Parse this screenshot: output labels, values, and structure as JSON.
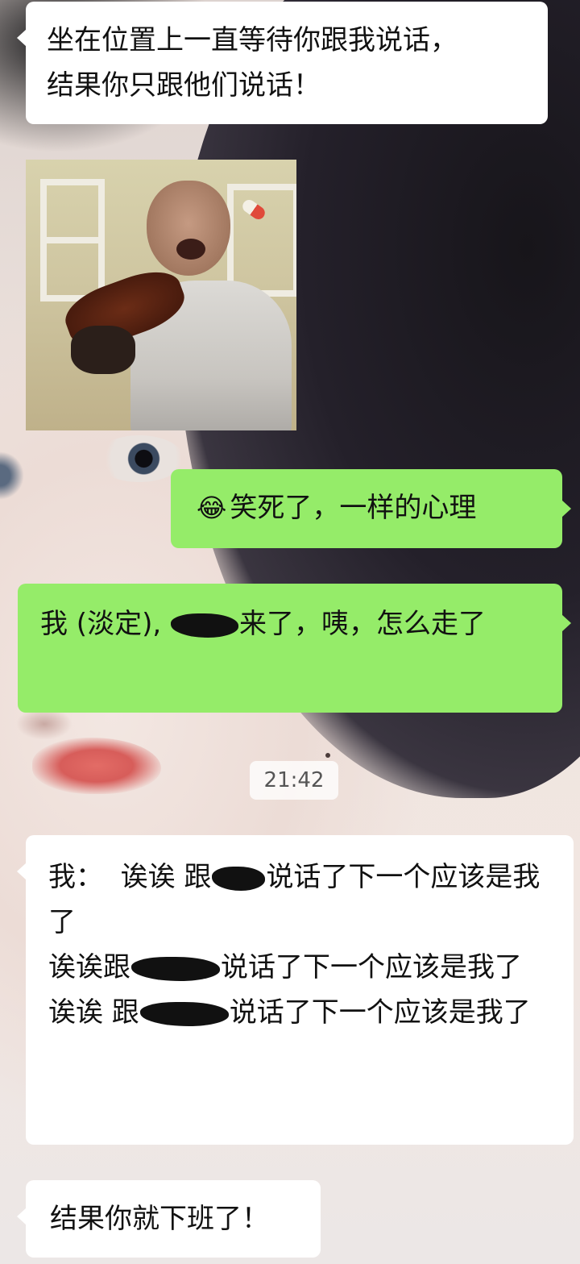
{
  "messages": [
    {
      "side": "incoming",
      "text": "坐在位置上一直等待你跟我说话，\n结果你只跟他们说话！"
    },
    {
      "side": "incoming",
      "type": "sticker",
      "sticker": "crying-violin-man"
    },
    {
      "side": "outgoing",
      "emoji": "😂",
      "text": "笑死了，一样的心理"
    },
    {
      "side": "outgoing",
      "text_before": "我 (淡定), ",
      "text_after": "来了，咦，怎么走了"
    },
    {
      "side": "timestamp",
      "text": "21:42"
    },
    {
      "side": "incoming",
      "lines": [
        {
          "before": "我：  诶诶 跟",
          "after": "说话了下一个应该是我了"
        },
        {
          "before": "诶诶跟",
          "after": "说话了下一个应该是我了"
        },
        {
          "before": "诶诶 跟",
          "after": "说话了下一个应该是我了"
        }
      ]
    },
    {
      "side": "incoming",
      "text": "结果你就下班了！"
    }
  ],
  "colors": {
    "outgoing_bubble": "#95ec69",
    "incoming_bubble": "#ffffff"
  }
}
